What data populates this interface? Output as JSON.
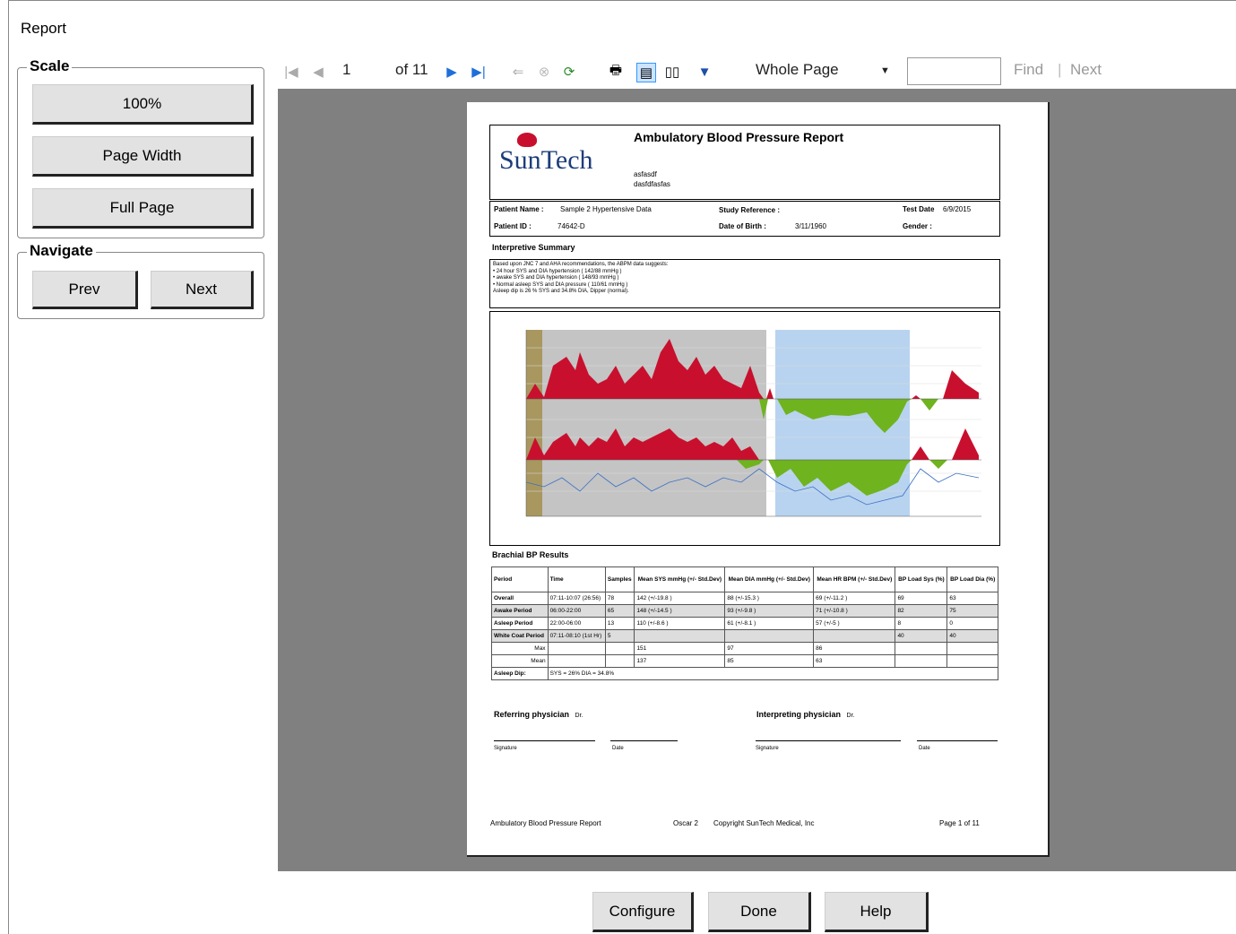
{
  "window": {
    "title": "Report"
  },
  "scale": {
    "legend": "Scale",
    "buttons": [
      "100%",
      "Page Width",
      "Full Page"
    ]
  },
  "navigate": {
    "legend": "Navigate",
    "prev": "Prev",
    "next": "Next"
  },
  "toolbar": {
    "page_current": "1",
    "page_of": "of 11",
    "zoom_value": "Whole Page",
    "find_value": "",
    "find_label": "Find",
    "separator": "|",
    "next_label": "Next"
  },
  "report": {
    "logo_text": "SunTech",
    "title": "Ambulatory Blood Pressure Report",
    "sub1": "asfasdf",
    "sub2": "dasfdfasfas",
    "patient_name_label": "Patient Name :",
    "patient_name": "Sample 2 Hypertensive Data",
    "study_ref_label": "Study Reference :",
    "test_date_label": "Test Date",
    "test_date": "6/9/2015",
    "patient_id_label": "Patient ID :",
    "patient_id": "74642-D",
    "dob_label": "Date of Birth :",
    "dob": "3/11/1960",
    "gender_label": "Gender :",
    "summary_heading": "Interpretive Summary",
    "summary_lines": [
      "Based upon JNC 7 and AHA recommendations, the ABPM data suggests:",
      "• 24 hour SYS and DIA hypertension ( 142/88 mmHg )",
      "• awake SYS and DIA hypertension ( 148/93 mmHg )",
      "• Normal asleep SYS and DIA pressure ( 110/61 mmHg )",
      "Asleep dip is 26 % SYS and 34.8% DIA, Dipper (normal)."
    ],
    "results_heading": "Brachial BP Results",
    "table_headers": [
      "Period",
      "Time",
      "Samples",
      "Mean SYS mmHg (+/- Std.Dev)",
      "Mean DIA mmHg (+/- Std.Dev)",
      "Mean HR BPM (+/- Std.Dev)",
      "BP Load Sys (%)",
      "BP Load Dia (%)"
    ],
    "table_rows": [
      [
        "Overall",
        "07:11-10:07 (26:56)",
        "78",
        "142 (+/-19.8 )",
        "88 (+/-15.3 )",
        "69 (+/-11.2 )",
        "69",
        "63"
      ],
      [
        "Awake Period",
        "06:00-22:00",
        "65",
        "148 (+/-14.5 )",
        "93 (+/-9.8 )",
        "71 (+/-10.8 )",
        "82",
        "75"
      ],
      [
        "Asleep Period",
        "22:00-06:00",
        "13",
        "110 (+/-8.6 )",
        "61 (+/-8.1 )",
        "57 (+/-5 )",
        "8",
        "0"
      ],
      [
        "White Coat Period",
        "07:11-08:10 (1st Hr)",
        "5",
        "",
        "",
        "",
        "40",
        "40"
      ],
      [
        "Max",
        "",
        "",
        "151",
        "97",
        "86",
        "",
        ""
      ],
      [
        "Mean",
        "",
        "",
        "137",
        "85",
        "63",
        "",
        ""
      ],
      [
        "Asleep Dip:",
        "SYS = 26%  DIA = 34.8%",
        "",
        "",
        "",
        "",
        "",
        ""
      ]
    ],
    "referring_label": "Referring physician",
    "referring_dr": "Dr.",
    "interpreting_label": "Interpreting physician",
    "interpreting_dr": "Dr.",
    "signature_label": "Signature",
    "date_label": "Date",
    "footer_left": "Ambulatory Blood Pressure Report",
    "footer_ver": "Oscar 2",
    "footer_copy": "Copyright SunTech Medical, Inc",
    "footer_page": "Page 1 of 11"
  },
  "bottom_buttons": {
    "configure": "Configure",
    "done": "Done",
    "help": "Help"
  },
  "colors": {
    "viewer_bg": "#808080",
    "chart_red": "#c8102e",
    "chart_green": "#6fb31f",
    "chart_blue_band": "#b8d3ef",
    "chart_grey_band": "#c4c4c4"
  }
}
